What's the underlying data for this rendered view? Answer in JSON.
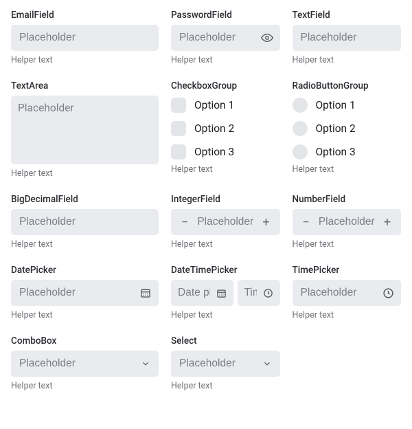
{
  "placeholder": "Placeholder",
  "helper": "Helper text",
  "datePlaceholder": "Date placeholder",
  "timePlaceholder": "Time",
  "labels": {
    "email": "EmailField",
    "password": "PasswordField",
    "text": "TextField",
    "textarea": "TextArea",
    "checkbox": "CheckboxGroup",
    "radio": "RadioButtonGroup",
    "bigdecimal": "BigDecimalField",
    "integer": "IntegerField",
    "number": "NumberField",
    "date": "DatePicker",
    "datetime": "DateTimePicker",
    "time": "TimePicker",
    "combobox": "ComboBox",
    "select": "Select"
  },
  "options": {
    "o1": "Option 1",
    "o2": "Option 2",
    "o3": "Option 3"
  }
}
